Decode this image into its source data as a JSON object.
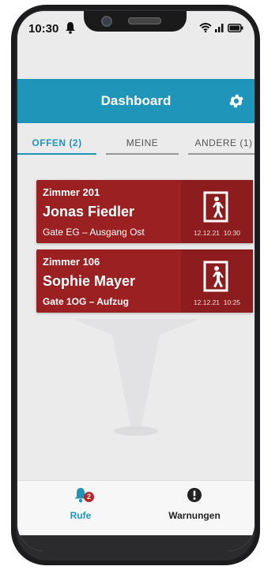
{
  "status_bar": {
    "time": "10:30"
  },
  "header": {
    "title": "Dashboard",
    "settings_icon": "gear-icon"
  },
  "tabs": [
    {
      "label": "OFFEN (2)",
      "active": true
    },
    {
      "label": "MEINE",
      "active": false
    },
    {
      "label": "ANDERE (1)",
      "active": false
    }
  ],
  "cards": [
    {
      "room": "Zimmer 201",
      "name": "Jonas Fiedler",
      "gate": "Gate EG – Ausgang Ost",
      "date": "12.12.21",
      "time": "10:30",
      "icon": "exit-door-icon"
    },
    {
      "room": "Zimmer 106",
      "name": "Sophie Mayer",
      "gate": "Gate 1OG – Aufzug",
      "date": "12.12.21",
      "time": "10:25",
      "icon": "exit-door-icon"
    }
  ],
  "bottom_nav": {
    "calls": {
      "label": "Rufe",
      "badge": "2",
      "icon": "bell-icon"
    },
    "warnings": {
      "label": "Warnungen",
      "icon": "exclamation-circle-icon"
    }
  },
  "colors": {
    "header": "#1f95ba",
    "card": "#9b2021",
    "accent_text": "#1f95ba"
  }
}
